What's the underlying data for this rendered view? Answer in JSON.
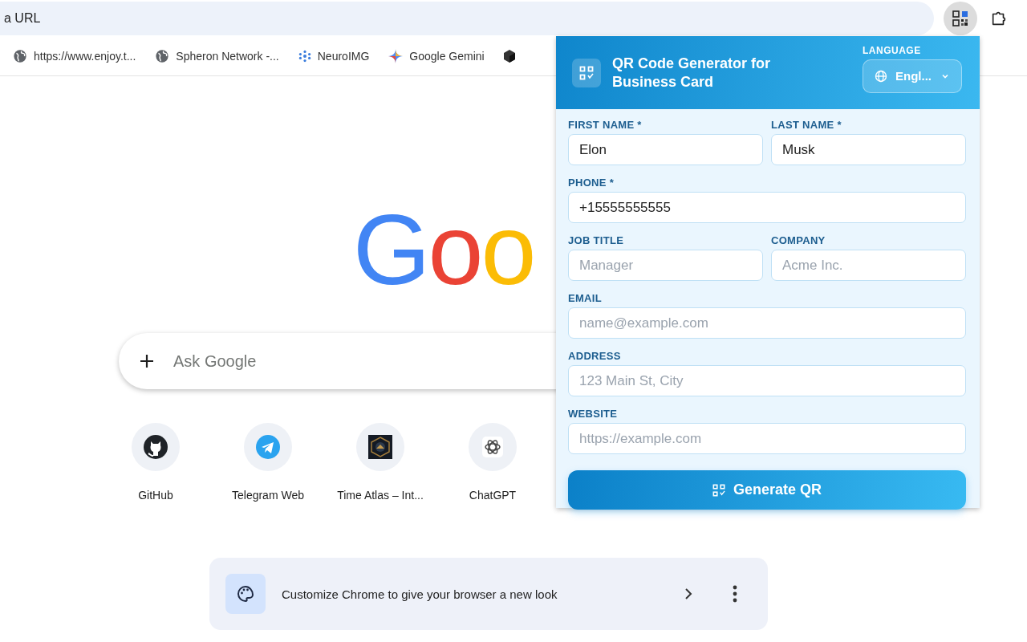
{
  "address_bar": {
    "text": "a URL"
  },
  "toolbar": {
    "extension_selected": true
  },
  "bookmarks": [
    {
      "label": "https://www.enjoy.t...",
      "kind": "globe"
    },
    {
      "label": "Spheron Network -...",
      "kind": "globe"
    },
    {
      "label": "NeuroIMG",
      "kind": "network"
    },
    {
      "label": "Google Gemini",
      "kind": "sparkle"
    },
    {
      "kind": "cube"
    }
  ],
  "logo": [
    {
      "char": "G",
      "color": "#4285f4"
    },
    {
      "char": "o",
      "color": "#ea4335"
    },
    {
      "char": "o",
      "color": "#fbbc05"
    }
  ],
  "search": {
    "placeholder": "Ask Google"
  },
  "shortcuts": [
    {
      "label": "GitHub",
      "kind": "cat"
    },
    {
      "label": "Telegram Web",
      "kind": "plane"
    },
    {
      "label": "Time Atlas – Int...",
      "kind": "picture"
    },
    {
      "label": "ChatGPT",
      "kind": "knot"
    }
  ],
  "customize_card": {
    "text": "Customize Chrome to give your browser a new look"
  },
  "popup": {
    "title": "QR Code Generator for Business Card",
    "language_label": "LANGUAGE",
    "language": "Engl...",
    "rows": [
      [
        {
          "label": "FIRST NAME *",
          "value": "Elon"
        },
        {
          "label": "LAST NAME *",
          "value": "Musk"
        }
      ],
      [
        {
          "label": "PHONE *",
          "value": "+15555555555"
        }
      ],
      [
        {
          "label": "JOB TITLE",
          "placeholder": "Manager"
        },
        {
          "label": "COMPANY",
          "placeholder": "Acme Inc."
        }
      ],
      [
        {
          "label": "EMAIL",
          "placeholder": "name@example.com"
        }
      ],
      [
        {
          "label": "ADDRESS",
          "placeholder": "123 Main St, City"
        }
      ],
      [
        {
          "label": "WEBSITE",
          "placeholder": "https://example.com"
        }
      ]
    ],
    "button": "Generate QR"
  }
}
